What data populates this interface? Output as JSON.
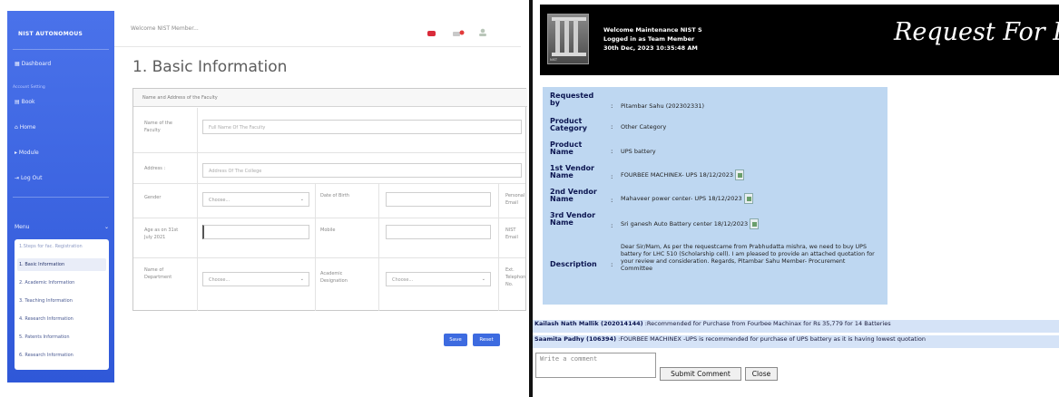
{
  "left": {
    "sidebar": {
      "brand": "NIST AUTONOMOUS",
      "items": [
        "Dashboard",
        "Book",
        "Home",
        "Module",
        "Log Out"
      ],
      "heading": "Account Setting",
      "menu_label": "Menu",
      "submenu": [
        "1.Steps for fac. Registration",
        "1. Basic Information",
        "2. Academic Information",
        "3. Teaching Information",
        "4. Research Information",
        "5. Patents Information",
        "6. Research Information"
      ]
    },
    "topbar": {
      "welcome": "Welcome NIST Member..."
    },
    "page_heading": "1. Basic Information",
    "form": {
      "section_title": "Name and Address of the Faculty",
      "name_label": "Name of the Faculty",
      "name_placeholder": "Full Name Of The Faculty",
      "address_label": "Address :",
      "address_placeholder": "Address Of The College",
      "gender_label": "Gender",
      "gender_value": "Choose...",
      "dob_label": "Date of Birth",
      "personal_email_label": "Personal Email",
      "age_label": "Age as on 31st July 2021",
      "mobile_label": "Mobile",
      "nist_email_label": "NIST Email",
      "department_label": "Name of Department",
      "department_value": "Choose...",
      "designation_label": "Academic Designation",
      "designation_value": "Choose...",
      "ext_label": "Ext. Telephone No."
    },
    "buttons": {
      "save": "Save",
      "reset": "Reset"
    }
  },
  "right": {
    "header": {
      "welcome": "Welcome Maintenance NIST S",
      "logged_in": "Logged in as Team Member",
      "date": "30th Dec, 2023 10:35:48 AM",
      "title": "Request For Pro",
      "logo_text": "NIST"
    },
    "request": {
      "requested_by_label": "Requested by",
      "requested_by": "Pitambar Sahu (202302331)",
      "category_label": "Product Category",
      "category": "Other Category",
      "product_label": "Product Name",
      "product": "UPS battery",
      "vendor1_label": "1st Vendor Name",
      "vendor1": "FOURBEE MACHINEX- UPS 18/12/2023",
      "vendor2_label": "2nd Vendor Name",
      "vendor2": "Mahaveer power center- UPS 18/12/2023",
      "vendor3_label": "3rd Vendor Name",
      "vendor3": "Sri ganesh Auto Battery center 18/12/2023",
      "description_label": "Description",
      "description": "Dear Sir/Mam, As per the requestcame from Prabhudatta mishra, we need to buy UPS battery for LHC 510 (Scholarship cell). I am pleased to provide an attached quotation for your review and consideration. Regards, Pitambar Sahu Member- Procurement Committee"
    },
    "comments": [
      {
        "author": "Kailash Nath Mallik (202014144)",
        "text": ":Recommended for Purchase from Fourbee Machinax for Rs 35,779 for 14 Batteries"
      },
      {
        "author": "Saamita Padhy (106394)",
        "text": ":FOURBEE MACHINEX -UPS is recommended for purchase of UPS battery as it is having lowest quotation"
      }
    ],
    "comment_placeholder": "Write a comment",
    "submit_label": "Submit Comment",
    "close_label": "Close"
  }
}
